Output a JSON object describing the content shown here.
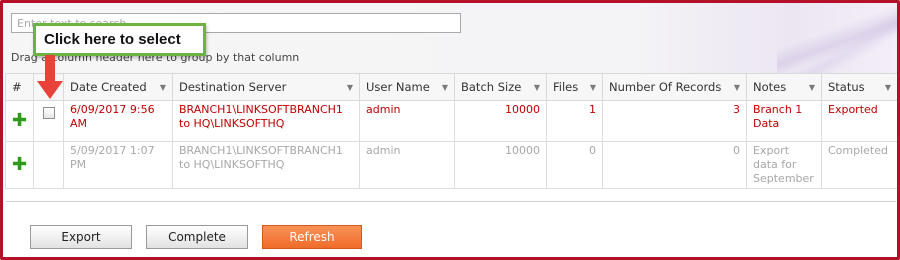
{
  "search": {
    "placeholder": "Enter text to search..."
  },
  "group_panel": {
    "text": "Drag a column header here to group by that column"
  },
  "callout": {
    "text": "Click here to select"
  },
  "table": {
    "headers": [
      "#",
      "",
      "Date Created",
      "Destination Server",
      "User Name",
      "Batch Size",
      "Files",
      "Number Of Records",
      "Notes",
      "Status"
    ],
    "rows": [
      {
        "date": "6/09/2017 9:56 AM",
        "server": "BRANCH1\\LINKSOFTBRANCH1 to HQ\\LINKSOFTHQ",
        "user": "admin",
        "batch": "10000",
        "files": "1",
        "records": "3",
        "notes": "Branch 1 Data",
        "status": "Exported"
      },
      {
        "date": "5/09/2017 1:07 PM",
        "server": "BRANCH1\\LINKSOFTBRANCH1 to HQ\\LINKSOFTHQ",
        "user": "admin",
        "batch": "10000",
        "files": "0",
        "records": "0",
        "notes": "Export data for September",
        "status": "Completed"
      }
    ]
  },
  "buttons": {
    "export": "Export",
    "complete": "Complete",
    "refresh": "Refresh"
  },
  "colors": {
    "frame": "#b5102a",
    "callout_border": "#6db33f",
    "arrow": "#e8423a",
    "add_icon": "#2e9a1a",
    "refresh_button": "#ef6c2a",
    "exported_row_text": "#c00000"
  },
  "icons": {
    "add": "plus-icon",
    "filter": "filter-icon"
  }
}
